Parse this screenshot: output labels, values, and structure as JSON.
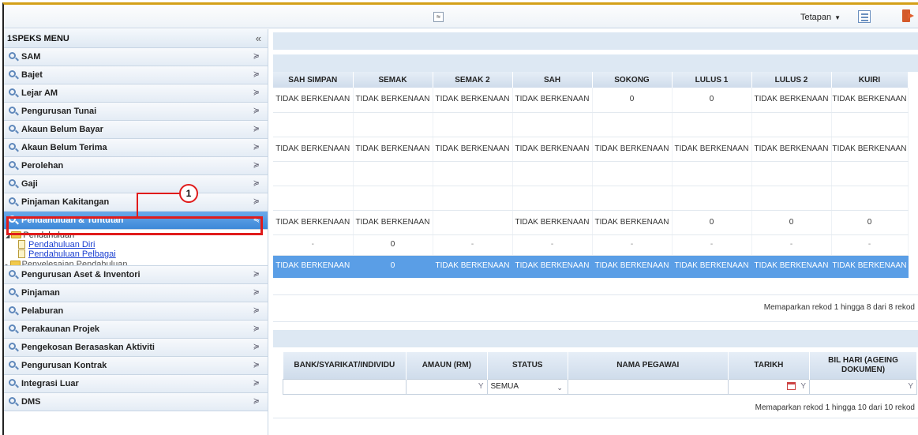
{
  "topbar": {
    "collapse_glyph": "≈",
    "settings_label": "Tetapan",
    "settings_caret": "▼",
    "icons": [
      "list-view-icon",
      "logout-icon"
    ]
  },
  "sidebar": {
    "title": "1SPEKS MENU",
    "collapse_glyph": "«",
    "items_before": [
      {
        "label": "SAM"
      },
      {
        "label": "Bajet"
      },
      {
        "label": "Lejar AM"
      },
      {
        "label": "Pengurusan Tunai"
      },
      {
        "label": "Akaun Belum Bayar"
      },
      {
        "label": "Akaun Belum Terima"
      },
      {
        "label": "Perolehan"
      },
      {
        "label": "Gaji"
      },
      {
        "label": "Pinjaman Kakitangan"
      }
    ],
    "active_item": {
      "label": "Pendahuluan & Tuntutan"
    },
    "tree": {
      "folder": "Pendahuluan",
      "leaves": [
        "Pendahuluan Diri",
        "Pendahuluan Pelbagai"
      ],
      "partial": "Penyelesaian Pendahuluan"
    },
    "items_after": [
      {
        "label": "Pengurusan Aset & Inventori"
      },
      {
        "label": "Pinjaman"
      },
      {
        "label": "Pelaburan"
      },
      {
        "label": "Perakaunan Projek"
      },
      {
        "label": "Pengekosan Berasaskan Aktiviti"
      },
      {
        "label": "Pengurusan Kontrak"
      },
      {
        "label": "Integrasi Luar"
      },
      {
        "label": "DMS"
      }
    ],
    "expand_glyph": "≽",
    "collapse_item_glyph": "≼",
    "callout_number": "1"
  },
  "status_grid": {
    "columns": [
      "SAH SIMPAN",
      "SEMAK",
      "SEMAK 2",
      "SAH",
      "SOKONG",
      "LULUS 1",
      "LULUS 2",
      "KUIRI"
    ],
    "rows": [
      [
        "TIDAK BERKENAAN",
        "TIDAK BERKENAAN",
        "TIDAK BERKENAAN",
        "TIDAK BERKENAAN",
        "0",
        "0",
        "TIDAK BERKENAAN",
        "TIDAK BERKENAAN"
      ],
      [
        "",
        "",
        "",
        "",
        "",
        "",
        "",
        ""
      ],
      [
        "TIDAK BERKENAAN",
        "TIDAK BERKENAAN",
        "TIDAK BERKENAAN",
        "TIDAK BERKENAAN",
        "TIDAK BERKENAAN",
        "TIDAK BERKENAAN",
        "TIDAK BERKENAAN",
        "TIDAK BERKENAAN"
      ],
      [
        "",
        "",
        "",
        "",
        "",
        "",
        "",
        ""
      ],
      [
        "",
        "",
        "",
        "",
        "",
        "",
        "",
        ""
      ],
      [
        "TIDAK BERKENAAN",
        "TIDAK BERKENAAN",
        "",
        "TIDAK BERKENAAN",
        "TIDAK BERKENAAN",
        "0",
        "0",
        "0"
      ],
      [
        "-",
        "0",
        "-",
        "-",
        "-",
        "-",
        "-",
        "-"
      ],
      [
        "TIDAK BERKENAAN",
        "0",
        "TIDAK BERKENAAN",
        "TIDAK BERKENAAN",
        "TIDAK BERKENAAN",
        "TIDAK BERKENAAN",
        "TIDAK BERKENAAN",
        "TIDAK BERKENAAN"
      ]
    ],
    "selected_row": 7,
    "pager": "Memaparkan rekod 1 hingga 8 dari 8 rekod"
  },
  "claims_grid": {
    "columns": [
      "BANK/SYARIKAT/INDIVIDU",
      "AMAUN (RM)",
      "STATUS",
      "NAMA PEGAWAI",
      "TARIKH",
      "BIL HARI (AGEING DOKUMEN)"
    ],
    "filter_status": "SEMUA",
    "filter_glyph": "Y",
    "dropdown_glyph": "⌄",
    "pager": "Memaparkan rekod 1 hingga 10 dari 10 rekod"
  }
}
